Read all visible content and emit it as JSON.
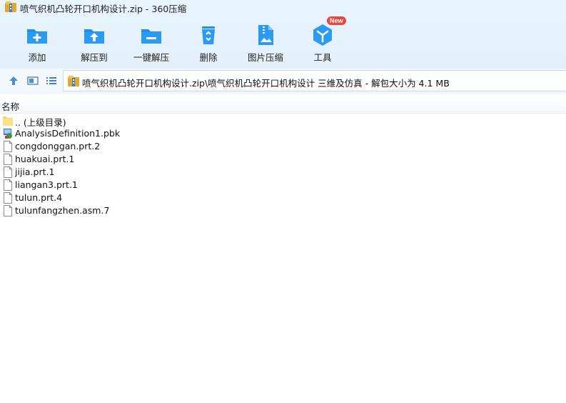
{
  "window": {
    "title": "喷气织机凸轮开口机构设计.zip - 360压缩"
  },
  "toolbar": {
    "items": [
      {
        "label": "添加",
        "icon": "add-icon"
      },
      {
        "label": "解压到",
        "icon": "extract-to-icon"
      },
      {
        "label": "一键解压",
        "icon": "one-click-extract-icon"
      },
      {
        "label": "删除",
        "icon": "delete-icon"
      },
      {
        "label": "图片压缩",
        "icon": "image-compress-icon"
      },
      {
        "label": "工具",
        "icon": "tools-icon",
        "badge": "New"
      }
    ],
    "accent": "#2b9af3",
    "badge_color": "#f0443a"
  },
  "address": {
    "path": "喷气织机凸轮开口机构设计.zip\\喷气织机凸轮开口机构设计 三维及仿真 - 解包大小为 4.1 MB"
  },
  "columns": {
    "name": "名称"
  },
  "files": [
    {
      "name": ".. (上级目录)",
      "type": "folder-up"
    },
    {
      "name": "AnalysisDefinition1.pbk",
      "type": "app"
    },
    {
      "name": "congdonggan.prt.2",
      "type": "file"
    },
    {
      "name": "huakuai.prt.1",
      "type": "file"
    },
    {
      "name": "jijia.prt.1",
      "type": "file"
    },
    {
      "name": "liangan3.prt.1",
      "type": "file"
    },
    {
      "name": "tulun.prt.4",
      "type": "file"
    },
    {
      "name": "tulunfangzhen.asm.7",
      "type": "file"
    }
  ]
}
